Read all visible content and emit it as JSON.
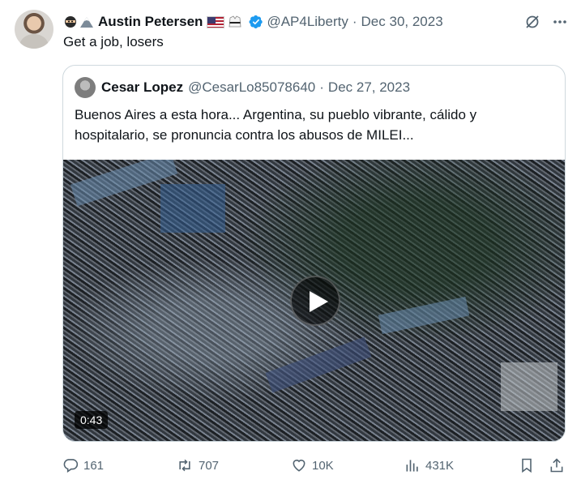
{
  "tweet": {
    "author_name": "Austin Petersen",
    "handle": "@AP4Liberty",
    "separator": "·",
    "date": "Dec 30, 2023",
    "text": "Get a job, losers"
  },
  "quoted": {
    "author_name": "Cesar Lopez",
    "handle": "@CesarLo85078640",
    "separator": "·",
    "date": "Dec 27, 2023",
    "text": "Buenos Aires a esta hora... Argentina, su pueblo vibrante,  cálido y hospitalario, se pronuncia contra los abusos de MILEI...",
    "video_duration": "0:43"
  },
  "stats": {
    "replies": "161",
    "reposts": "707",
    "likes": "10K",
    "views": "431K"
  },
  "colors": {
    "verified": "#1d9bf0",
    "secondary_text": "#536471",
    "border": "#cfd9de"
  },
  "icons": [
    "ninja-emoji",
    "mountain-emoji",
    "us-flag-emoji",
    "martial-arts-uniform-emoji",
    "verified-badge",
    "grok-icon",
    "more-icon",
    "play-icon",
    "reply-icon",
    "repost-icon",
    "like-icon",
    "views-icon",
    "bookmark-icon",
    "share-icon"
  ]
}
